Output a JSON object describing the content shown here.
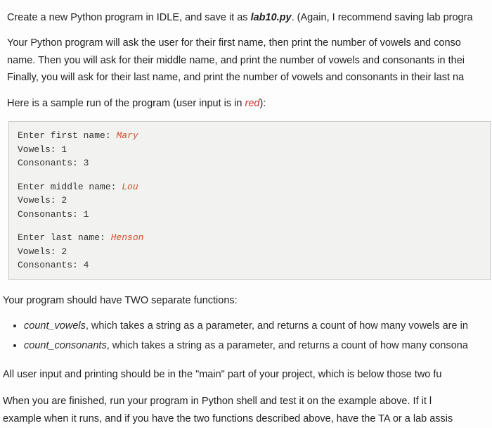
{
  "intro": {
    "line1_a": "Create a new Python program in IDLE, and save it as ",
    "line1_file": "lab10.py",
    "line1_b": ". (Again, I recommend saving lab progra",
    "line2": "Your Python program will ask the user for their first name, then print the number of vowels and conso",
    "line3": "name. Then you will ask for their middle name, and print the number of vowels and consonants in thei",
    "line4": "Finally, you will ask for their last name, and print the number of vowels and consonants in their last na",
    "line5_a": "Here is a sample run of the program (user input is in ",
    "line5_b": "red",
    "line5_c": "):"
  },
  "sample": {
    "g1": {
      "prompt": "Enter first name: ",
      "user": "Mary",
      "vowels": "Vowels: 1",
      "cons": "Consonants: 3"
    },
    "g2": {
      "prompt": "Enter middle name: ",
      "user": "Lou",
      "vowels": "Vowels: 2",
      "cons": "Consonants: 1"
    },
    "g3": {
      "prompt": "Enter last name: ",
      "user": "Henson",
      "vowels": "Vowels: 2",
      "cons": "Consonants: 4"
    }
  },
  "funcs": {
    "heading": "Your program should have TWO separate functions:",
    "item1_fn": "count_vowels",
    "item1_rest": ", which takes a string as a parameter, and returns a count of how many vowels are in",
    "item2_fn": "count_consonants",
    "item2_rest": ", which takes a string as a parameter, and returns a count of how many consona"
  },
  "closing": {
    "p1": "All user input and printing should be in the \"main\" part of your project, which is below those two fu",
    "p2": "When you are finished, run your program in Python shell and test it on the example above. If it l",
    "p3": "example when it runs, and if you have the two functions described above, have the TA or a lab assis"
  }
}
